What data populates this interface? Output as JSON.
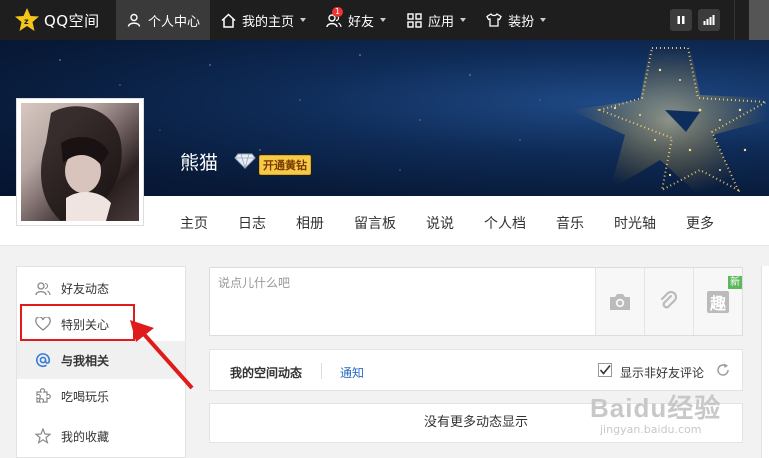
{
  "topbar": {
    "logo_text": "QQ空间",
    "nav": [
      {
        "label": "个人中心",
        "icon": "person-icon"
      },
      {
        "label": "我的主页",
        "icon": "home-icon"
      },
      {
        "label": "好友",
        "icon": "friends-icon",
        "badge": "1"
      },
      {
        "label": "应用",
        "icon": "apps-grid-icon"
      },
      {
        "label": "装扮",
        "icon": "shirt-icon"
      }
    ]
  },
  "profile": {
    "nickname": "熊猫",
    "vip_label": "开通黄钻"
  },
  "tabs": [
    "主页",
    "日志",
    "相册",
    "留言板",
    "说说",
    "个人档",
    "音乐",
    "时光轴",
    "更多"
  ],
  "sidebar": {
    "items": [
      {
        "label": "好友动态",
        "icon": "friends-feed-icon"
      },
      {
        "label": "特别关心",
        "icon": "heart-icon"
      },
      {
        "label": "与我相关",
        "icon": "at-icon"
      },
      {
        "label": "吃喝玩乐",
        "icon": "puzzle-icon"
      },
      {
        "label": "我的收藏",
        "icon": "star-icon"
      }
    ]
  },
  "composer": {
    "placeholder": "说点儿什么吧",
    "fun_label": "趣",
    "new_tag": "新"
  },
  "feed": {
    "tab_mine": "我的空间动态",
    "tab_notice": "通知",
    "show_non_friend": "显示非好友评论",
    "no_more": "没有更多动态显示"
  },
  "watermark": {
    "main": "Baidu经验",
    "sub": "jingyan.baidu.com"
  },
  "colors": {
    "topbar_bg": "#1e1e1e",
    "highlight": "#e01b1b",
    "link": "#2a6cc4"
  }
}
